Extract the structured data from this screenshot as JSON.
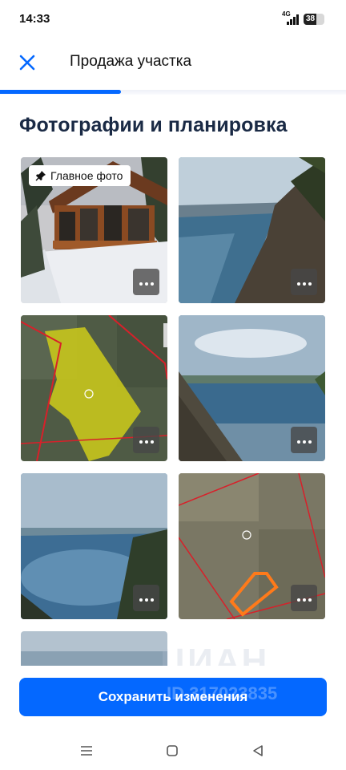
{
  "status_bar": {
    "time": "14:33",
    "network": "4G",
    "battery": "38"
  },
  "header": {
    "title": "Продажа участка",
    "progress": 0.35
  },
  "section": {
    "title": "Фотографии и планировка"
  },
  "photos": {
    "main_label": "Главное фото",
    "items": [
      {
        "kind": "house"
      },
      {
        "kind": "river-cliff"
      },
      {
        "kind": "plot-map-yellow"
      },
      {
        "kind": "lake-shore"
      },
      {
        "kind": "river-wide"
      },
      {
        "kind": "plot-map-orange"
      },
      {
        "kind": "partial"
      }
    ]
  },
  "watermark": {
    "text": "ЦИАН",
    "id": "ID 317023835"
  },
  "footer": {
    "save_label": "Сохранить изменения"
  },
  "icons": {
    "close": "close-icon",
    "pin": "pin-icon",
    "more": "more-icon",
    "nav_menu": "menu-icon",
    "nav_home": "home-icon",
    "nav_back": "back-icon"
  },
  "colors": {
    "accent": "#0468ff",
    "title": "#1a2a45"
  }
}
